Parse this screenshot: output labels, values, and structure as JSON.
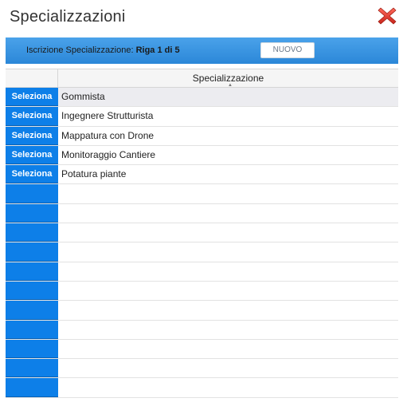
{
  "dialog": {
    "title": "Specializzazioni",
    "close_icon": "close-x-icon",
    "close_color": "#e33b2e"
  },
  "toolbar": {
    "info_label": "Iscrizione Specializzazione:",
    "info_value": "Riga 1 di 5",
    "new_label": "NUOVO",
    "accent": "#2b87d8"
  },
  "grid": {
    "column_header": "Specializzazione",
    "sort_direction": "ascending",
    "select_label": "Seleziona",
    "select_color": "#0d7fe8",
    "rows": [
      "Gommista",
      "Ingegnere Strutturista",
      "Mappatura con Drone",
      "Monitoraggio Cantiere",
      "Potatura piante"
    ],
    "empty_row_count": 11
  }
}
